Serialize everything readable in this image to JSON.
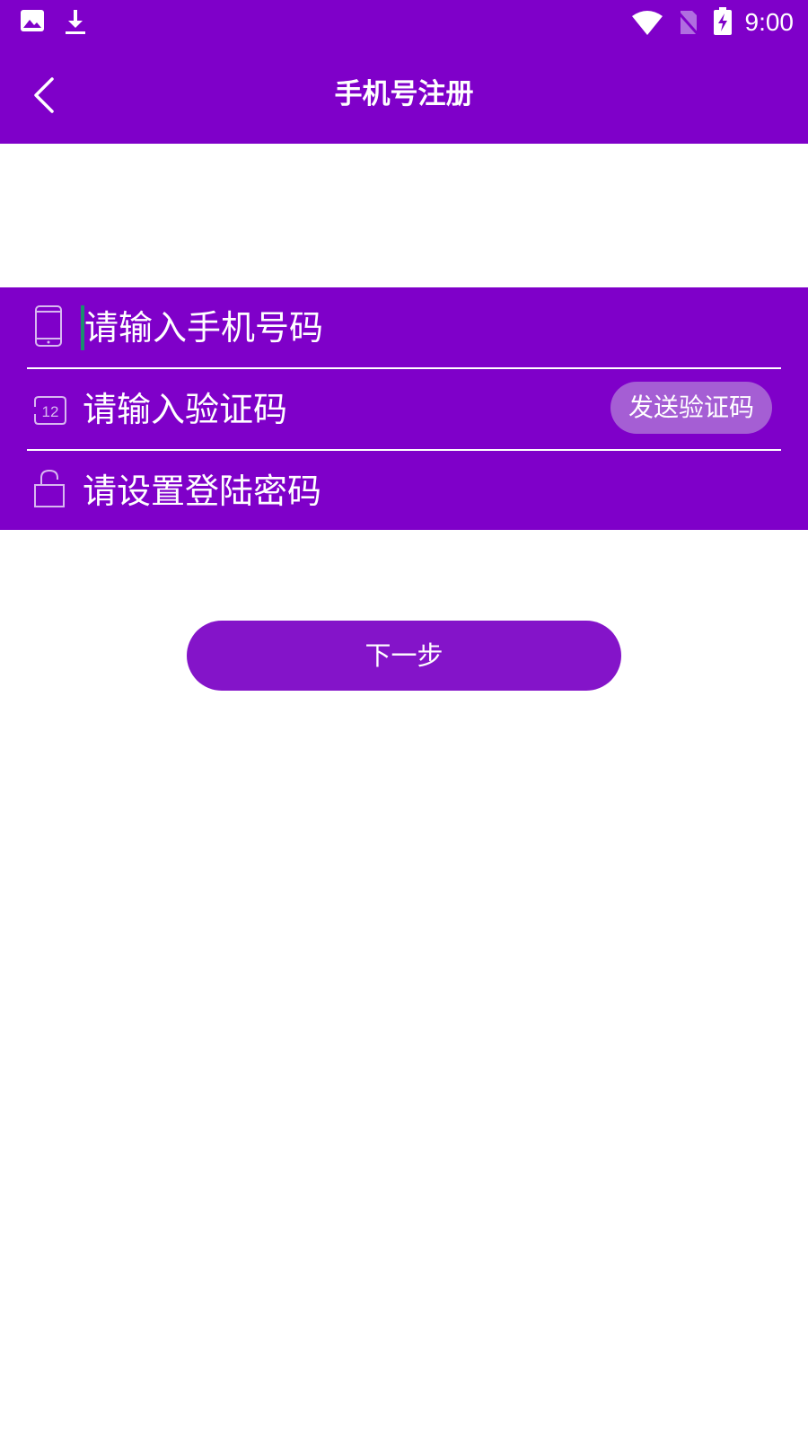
{
  "status_bar": {
    "time": "9:00",
    "left_icons": [
      "image-icon",
      "download-icon"
    ],
    "right_icons": [
      "wifi-icon",
      "no-sim-icon",
      "battery-charging-icon"
    ]
  },
  "app_bar": {
    "title": "手机号注册",
    "back_icon": "chevron-left-icon"
  },
  "form": {
    "phone": {
      "placeholder": "请输入手机号码",
      "value": "",
      "icon": "phone-icon"
    },
    "code": {
      "placeholder": "请输入验证码",
      "value": "",
      "icon": "code-icon",
      "send_label": "发送验证码"
    },
    "password": {
      "placeholder": "请设置登陆密码",
      "value": "",
      "icon": "lock-icon"
    }
  },
  "next_button": {
    "label": "下一步"
  },
  "colors": {
    "primary": "#7f00c9",
    "button": "#8414c9",
    "send_button": "#a55ed4",
    "cursor": "#1a8f6e"
  }
}
